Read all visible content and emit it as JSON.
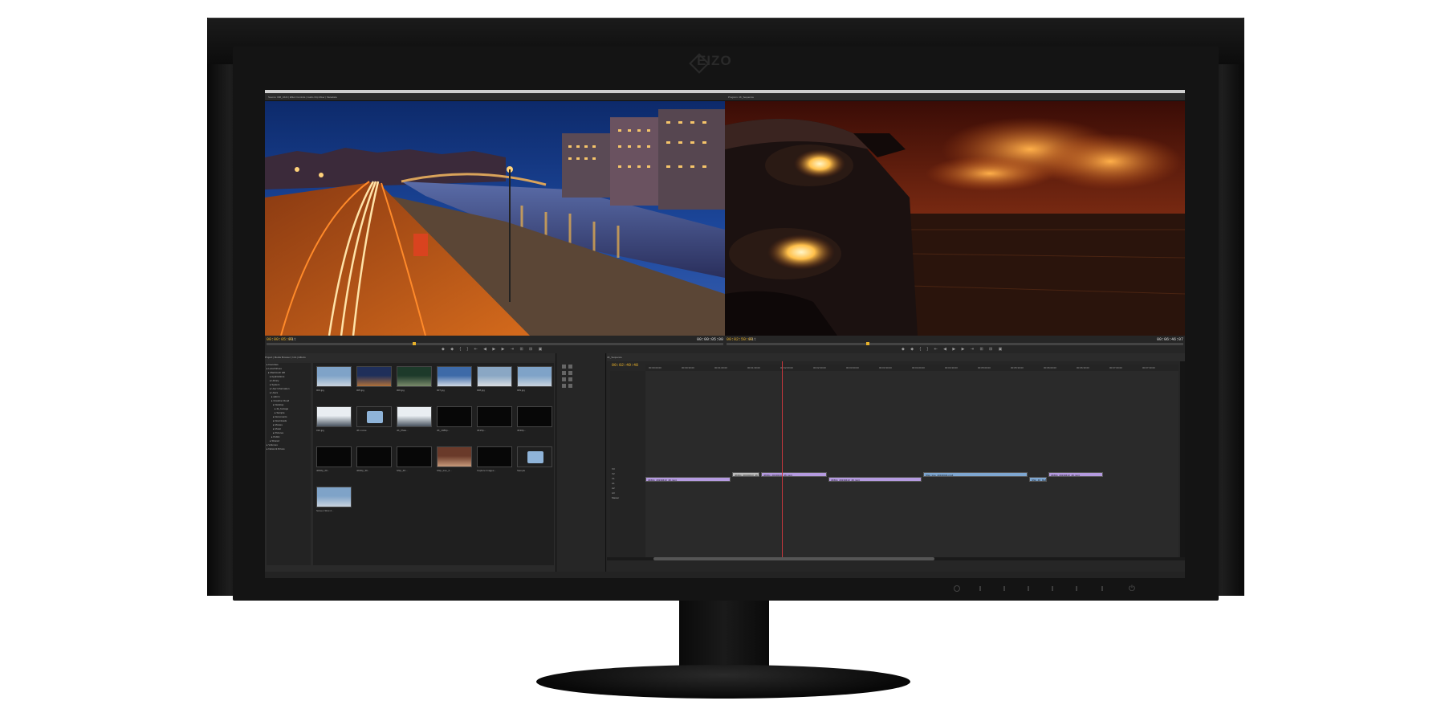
{
  "monitor": {
    "brand": "EIZO"
  },
  "screen": {
    "menubar_title": "",
    "source_tabs": "Source: 006_16x9 | Effect Controls | Audio Clip Mixer | Metadata",
    "program_tabs": "Program: 4K_Sequence",
    "source_viewer": {
      "scene": "night-city-river",
      "timecode_left": "00:00:05:09",
      "fit_label": "Fit",
      "timecode_right": "00:00:05:00"
    },
    "program_viewer": {
      "scene": "car-headlight-sunset",
      "timecode_left": "00:02:50:08",
      "fit_label": "Fit",
      "timecode_right": "00:06:46:07"
    },
    "transport_glyphs": "◆ ◆ { } ⇤ ◀ ▶ ▶ ⇥ ⊞ ⊞ ▣",
    "project": {
      "tabs": "Project | Media Browser | Info | Effects",
      "tree": [
        "Favorites",
        "Local Drives",
        "Macintosh HD",
        "Applications",
        "Library",
        "System",
        "User Information",
        "Users",
        "admin",
        "Creative Cloud",
        "Desktop",
        "4k_footage",
        "Sample",
        "Documents",
        "Downloads",
        "Movies",
        "Music",
        "Pictures",
        "Public",
        "Shared",
        "Volumes",
        "Network Drives"
      ],
      "items": [
        {
          "caption": "003.jpg",
          "kind": "city-day"
        },
        {
          "caption": "005.jpg",
          "kind": "city-night"
        },
        {
          "caption": "006.jpg",
          "kind": "street"
        },
        {
          "caption": "007.jpg",
          "kind": "river"
        },
        {
          "caption": "008.jpg",
          "kind": "building"
        },
        {
          "caption": "009.jpg",
          "kind": "city-day"
        },
        {
          "caption": "010.jpg",
          "kind": "snow"
        },
        {
          "caption": "4K movie",
          "kind": "folder"
        },
        {
          "caption": "4K_Plate...",
          "kind": "snow"
        },
        {
          "caption": "4K_1080p...",
          "kind": "black"
        },
        {
          "caption": "4K15p...",
          "kind": "black"
        },
        {
          "caption": "4K30p...",
          "kind": "black"
        },
        {
          "caption": "4K60p_20...",
          "kind": "black"
        },
        {
          "caption": "4K60p_30...",
          "kind": "black"
        },
        {
          "caption": "Ship_4K...",
          "kind": "black"
        },
        {
          "caption": "Ship_tree_2...",
          "kind": "boats"
        },
        {
          "caption": "Capture Images...",
          "kind": "black"
        },
        {
          "caption": "Sample",
          "kind": "folder"
        },
        {
          "caption": "Screen Shot 2...",
          "kind": "city-day"
        }
      ]
    },
    "timeline": {
      "tabs": "4K_Sequence",
      "timecode": "00:02:49:48",
      "ruler": [
        "00:00:00:00",
        "00:00:30:00",
        "00:01:00:00",
        "00:01:30:00",
        "00:02:00:00",
        "00:02:30:00",
        "00:03:00:00",
        "00:03:30:00",
        "00:04:00:00",
        "00:04:30:00",
        "00:05:00:00",
        "00:05:30:00",
        "00:06:00:00",
        "00:06:30:00",
        "00:07:00:00",
        "00:07:30:00"
      ],
      "tracks": [
        "V3",
        "V2",
        "V1",
        "A1",
        "A2",
        "A3",
        "Master"
      ],
      "clips": [
        {
          "label": "4K60p_20130413_4K.mp4",
          "track": "V1",
          "color": "v"
        },
        {
          "label": "4K60p_20130413_4K.mp4",
          "track": "V2",
          "color": "w"
        },
        {
          "label": "4K60p_20130413_4K.mp4",
          "track": "V2",
          "color": "v"
        },
        {
          "label": "4K60p_20130413_4K.mp4",
          "track": "V1",
          "color": "v"
        },
        {
          "label": "Ship_tree_20130411.mp4",
          "track": "V2",
          "color": "b"
        },
        {
          "label": "Ship_4K_Reflect",
          "track": "V1",
          "color": "b"
        },
        {
          "label": "4K60p_20130413_4K.mp4",
          "track": "V2",
          "color": "v"
        }
      ]
    }
  }
}
